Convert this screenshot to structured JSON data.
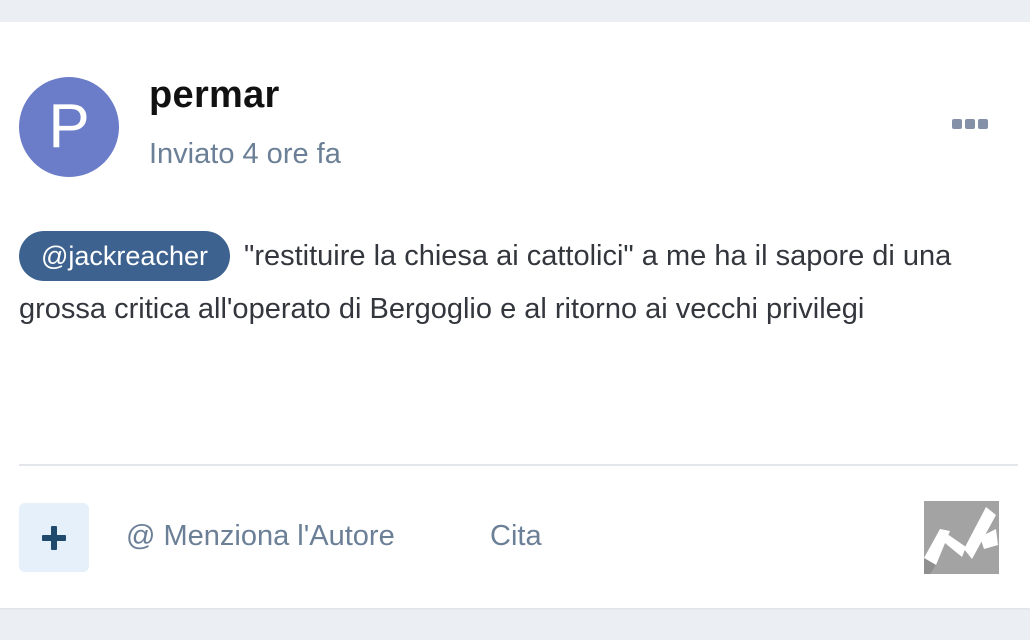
{
  "post": {
    "avatar_letter": "P",
    "avatar_color": "#6b7cc9",
    "author": "permar",
    "time": "Inviato 4 ore fa",
    "more_icon": "ellipsis-icon",
    "mention": "@jackreacher",
    "text": " \"restituire la chiesa ai cattolici\"  a me ha il sapore di una grossa critica all'operato di Bergoglio e al ritorno ai vecchi privilegi"
  },
  "actions": {
    "reaction_icon": "plus-icon",
    "mention_author": "@ Menziona l'Autore",
    "quote": "Cita",
    "logo_icon": "site-logo"
  },
  "colors": {
    "background": "#ebeef3",
    "card": "#ffffff",
    "mention_chip": "#3d628f",
    "muted_text": "#6b7f96",
    "reaction_button_bg": "#e5f0fa",
    "reaction_icon": "#1f4a6e"
  }
}
